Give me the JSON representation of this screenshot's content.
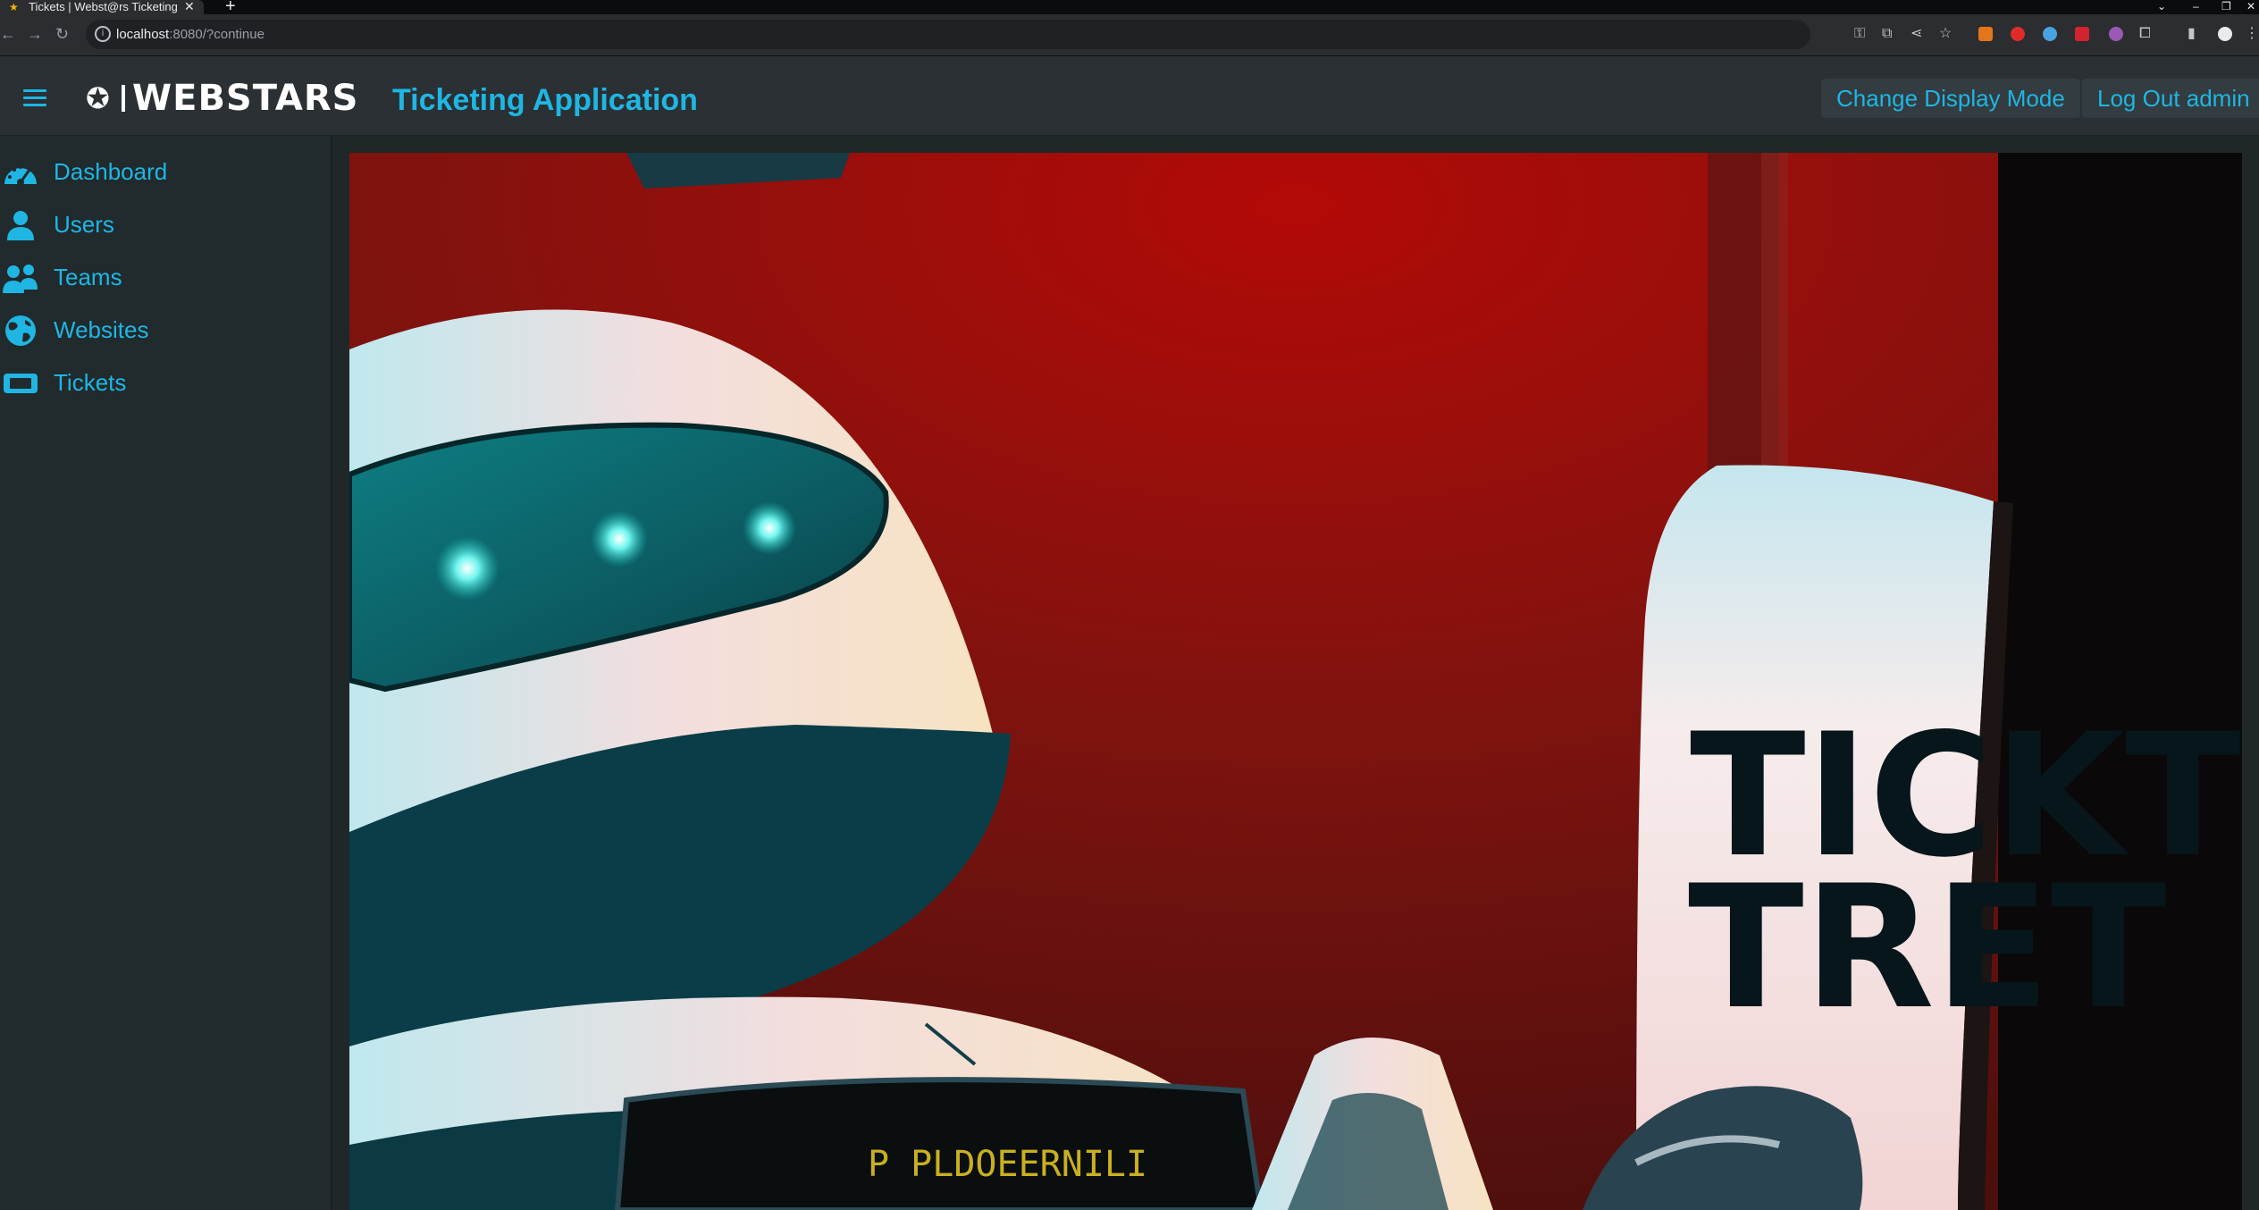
{
  "browser": {
    "tab_title": "Tickets | Webst@rs Ticketing Application",
    "tab_close": "✕",
    "new_tab": "+",
    "url_host": "localhost",
    "url_path": ":8080/?continue",
    "icons": [
      "back-icon",
      "forward-icon",
      "reload-icon",
      "site-info-icon",
      "key-icon",
      "open-external-icon",
      "share-icon",
      "bookmark-star-icon",
      "extensions-icon",
      "sidepanel-icon",
      "profile-icon",
      "menu-icon"
    ]
  },
  "header": {
    "logo_text": "WEBSTARS",
    "title": "Ticketing Application",
    "change_mode_label": "Change Display Mode",
    "logout_label": "Log Out admin",
    "accent": "#1fb6e3"
  },
  "sidebar": {
    "items": [
      {
        "label": "Dashboard",
        "icon": "gauge-icon"
      },
      {
        "label": "Users",
        "icon": "user-icon"
      },
      {
        "label": "Teams",
        "icon": "users-icon"
      },
      {
        "label": "Websites",
        "icon": "globe-icon"
      },
      {
        "label": "Tickets",
        "icon": "ticket-icon"
      }
    ]
  },
  "hero": {
    "sign_line1": "TICKT",
    "sign_line2": "TRET",
    "screen_text": "P  PLDOEERNILI"
  }
}
